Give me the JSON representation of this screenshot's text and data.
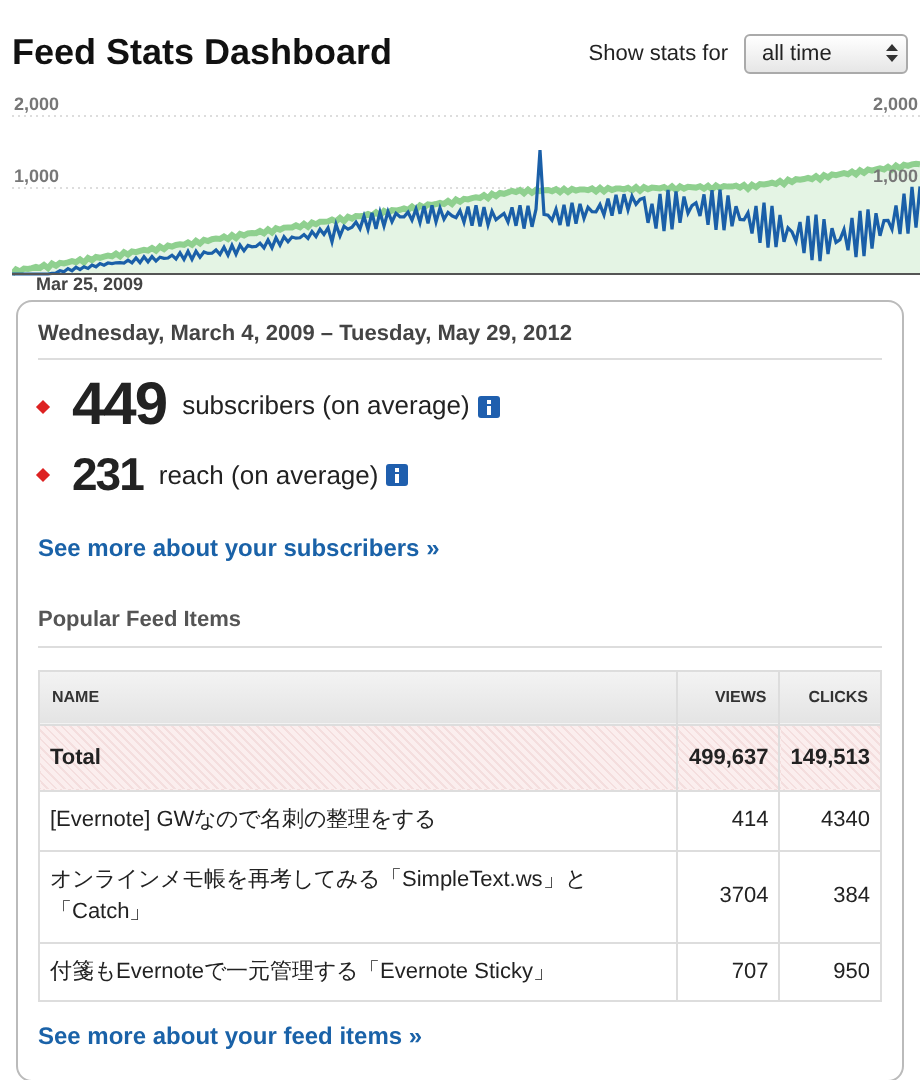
{
  "header": {
    "title": "Feed Stats Dashboard",
    "range_label": "Show stats for",
    "range_value": "all time"
  },
  "chart": {
    "left_ticks": [
      "2,000",
      "1,000"
    ],
    "right_ticks": [
      "2,000",
      "1,000"
    ],
    "start_label": "Mar 25, 2009"
  },
  "summary": {
    "period": "Wednesday, March 4, 2009 – Tuesday, May 29, 2012",
    "stats": [
      {
        "value": "449",
        "label": "subscribers (on average)",
        "kind": "primary"
      },
      {
        "value": "231",
        "label": "reach (on average)",
        "kind": "secondary"
      }
    ],
    "subscribers_link": "See more about your subscribers »"
  },
  "popular": {
    "heading": "Popular Feed Items",
    "columns": [
      "NAME",
      "VIEWS",
      "CLICKS"
    ],
    "rows": [
      {
        "kind": "total",
        "cells": [
          "Total",
          "499,637",
          "149,513"
        ]
      },
      {
        "kind": "item",
        "cells": [
          "[Evernote] GWなので名刺の整理をする",
          "414",
          "4340"
        ]
      },
      {
        "kind": "item",
        "cells": [
          "オンラインメモ帳を再考してみる「SimpleText.ws」と「Catch」",
          "3704",
          "384"
        ]
      },
      {
        "kind": "item",
        "cells": [
          "付箋もEvernoteで一元管理する「Evernote Sticky」",
          "707",
          "950"
        ]
      }
    ],
    "link": "See more about your feed items »"
  }
}
